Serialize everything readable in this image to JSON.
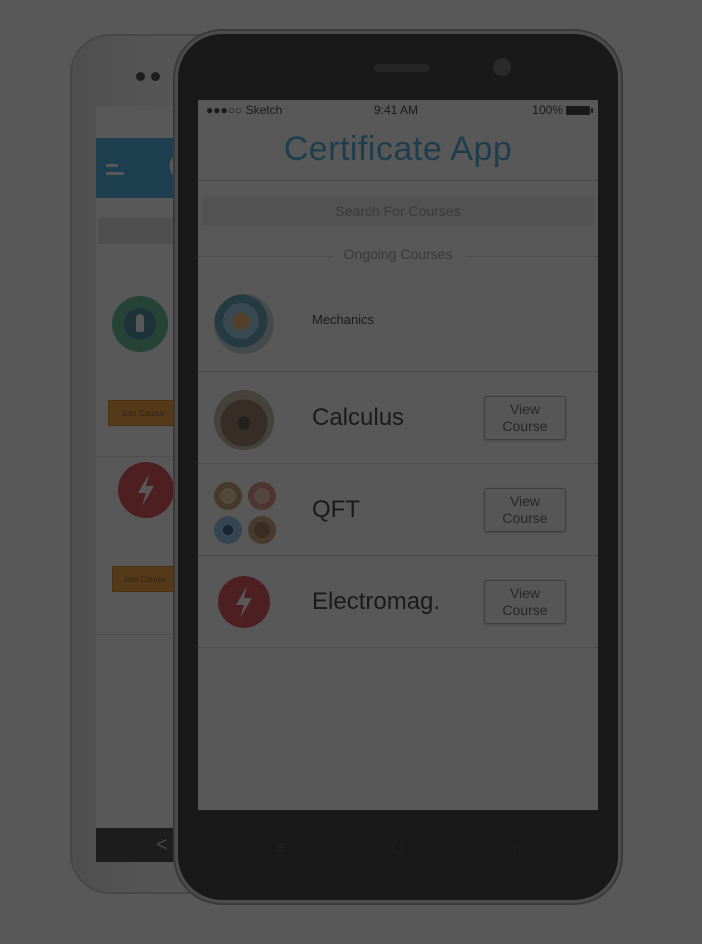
{
  "status_bar": {
    "carrier": "●●●○○ Sketch",
    "time": "9:41 AM",
    "battery": "100%"
  },
  "app": {
    "title": "Certificate App"
  },
  "search": {
    "placeholder": "Search For Courses"
  },
  "section": {
    "ongoing_label": "Ongoing Courses"
  },
  "courses": [
    {
      "name": "Mechanics",
      "avatar": "gear-mechanism-photo"
    },
    {
      "name": "Calculus",
      "avatar": "bear-photo",
      "button": "View Course"
    },
    {
      "name": "QFT",
      "avatar": "group-photos",
      "button": "View Course"
    },
    {
      "name": "Electromag.",
      "avatar": "lightning-bolt-icon",
      "button": "View Course"
    }
  ],
  "back_phone": {
    "join_labels": [
      "Join Course",
      "Join Course"
    ]
  },
  "colors": {
    "accent": "#1f9bd7",
    "flash_red": "#d8232a",
    "join_orange": "#f28c10",
    "rocket_green": "#3fb17a"
  }
}
